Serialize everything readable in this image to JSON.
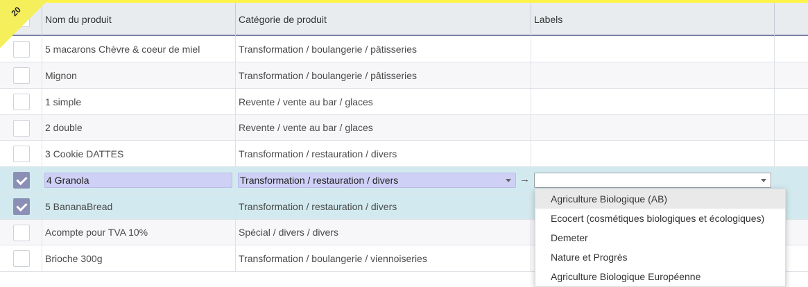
{
  "ribbon": {
    "text": "20"
  },
  "columns": {
    "name": "Nom du produit",
    "category": "Catégorie de produit",
    "labels": "Labels"
  },
  "rows": [
    {
      "name": "5 macarons Chèvre & coeur de miel",
      "category": "Transformation / boulangerie / pâtisseries",
      "labels": "",
      "checked": false
    },
    {
      "name": "Mignon",
      "category": "Transformation / boulangerie / pâtisseries",
      "labels": "",
      "checked": false
    },
    {
      "name": "1 simple",
      "category": "Revente / vente au bar / glaces",
      "labels": "",
      "checked": false
    },
    {
      "name": "2 double",
      "category": "Revente / vente au bar / glaces",
      "labels": "",
      "checked": false
    },
    {
      "name": "3 Cookie DATTES",
      "category": "Transformation / restauration / divers",
      "labels": "",
      "checked": false
    },
    {
      "name": "4 Granola",
      "category": "Transformation / restauration / divers",
      "labels": "",
      "checked": true,
      "editing": true
    },
    {
      "name": "5 BananaBread",
      "category": "Transformation / restauration / divers",
      "labels": "",
      "checked": true
    },
    {
      "name": "Acompte pour TVA 10%",
      "category": "Spécial / divers / divers",
      "labels": "",
      "checked": false
    },
    {
      "name": "Brioche 300g",
      "category": "Transformation / boulangerie / viennoiseries",
      "labels": "",
      "checked": false
    }
  ],
  "dropdown": {
    "items": [
      "Agriculture Biologique (AB)",
      "Ecocert (cosmétiques biologiques et écologiques)",
      "Demeter",
      "Nature et Progrès",
      "Agriculture Biologique Européenne"
    ],
    "active_index": 0
  },
  "colors": {
    "header_bg": "#e9ecef",
    "selected_row": "#d2eaef",
    "edit_field": "#cfd0f6",
    "ribbon": "#f4ef5a"
  }
}
